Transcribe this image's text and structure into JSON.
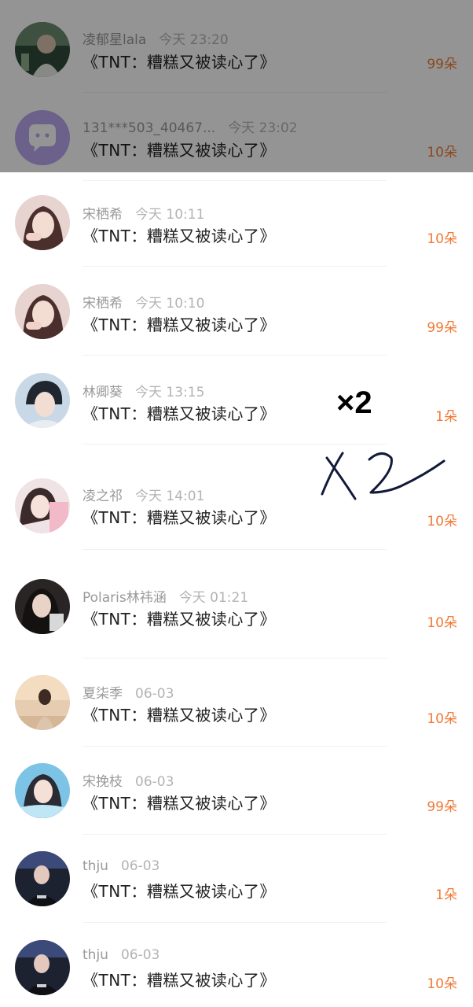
{
  "rows": [
    {
      "name": "凌郁星lala",
      "time": "今天 23:20",
      "title": "《TNT：糟糕又被读心了》",
      "flowers": "99朵",
      "avatar": "photo-dark-green"
    },
    {
      "name": "131***503_40467...",
      "time": "今天 23:02",
      "title": "《TNT：糟糕又被读心了》",
      "flowers": "10朵",
      "avatar": "chat-bubble-icon"
    },
    {
      "name": "宋栖希",
      "time": "今天 10:11",
      "title": "《TNT：糟糕又被读心了》",
      "flowers": "10朵",
      "avatar": "photo-girl-pink"
    },
    {
      "name": "宋栖希",
      "time": "今天 10:10",
      "title": "《TNT：糟糕又被读心了》",
      "flowers": "99朵",
      "avatar": "photo-girl-pink"
    },
    {
      "name": "林卿葵",
      "time": "今天 13:15",
      "title": "《TNT：糟糕又被读心了》",
      "flowers": "1朵",
      "avatar": "photo-boy-blue"
    },
    {
      "name": "凌之祁",
      "time": "今天 14:01",
      "title": "《TNT：糟糕又被读心了》",
      "flowers": "10朵",
      "avatar": "photo-girl-light"
    },
    {
      "name": "Polaris林祎涵",
      "time": "今天 01:21",
      "title": "《TNT：糟糕又被读心了》",
      "flowers": "10朵",
      "avatar": "photo-dark"
    },
    {
      "name": "夏柒季",
      "time": "06-03",
      "title": "《TNT：糟糕又被读心了》",
      "flowers": "10朵",
      "avatar": "photo-sunset"
    },
    {
      "name": "宋挽枝",
      "time": "06-03",
      "title": "《TNT：糟糕又被读心了》",
      "flowers": "99朵",
      "avatar": "photo-sea-blue"
    },
    {
      "name": "thju",
      "time": "06-03",
      "title": "《TNT：糟糕又被读心了》",
      "flowers": "1朵",
      "avatar": "photo-stage-dark"
    },
    {
      "name": "thju",
      "time": "06-03",
      "title": "《TNT：糟糕又被读心了》",
      "flowers": "10朵",
      "avatar": "photo-stage-dark"
    }
  ],
  "annotations": {
    "typed": "×2",
    "handwritten": "X2"
  },
  "colors": {
    "flower_count": "#f07a36",
    "title_text": "#202020",
    "meta_text": "#9a9a9a",
    "overlay": "rgba(0,0,0,0.42)"
  }
}
